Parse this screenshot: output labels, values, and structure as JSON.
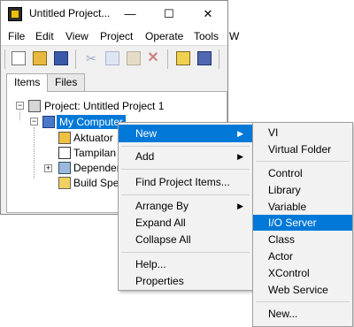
{
  "window": {
    "title": "Untitled Project...",
    "controls": {
      "minimize": "—",
      "maximize": "☐",
      "close": "✕"
    },
    "menu": [
      "File",
      "Edit",
      "View",
      "Project",
      "Operate",
      "Tools",
      "W"
    ],
    "tabs": [
      "Items",
      "Files"
    ],
    "active_tab": "Items"
  },
  "tree": {
    "project": "Project: Untitled Project 1",
    "computer": "My Computer",
    "children": [
      "Aktuator",
      "Tampilan",
      "Dependen",
      "Build Spe"
    ]
  },
  "context_menu": {
    "items": [
      "New",
      "Add",
      "Find Project Items...",
      "Arrange By",
      "Expand All",
      "Collapse All",
      "Help...",
      "Properties"
    ],
    "highlighted": "New"
  },
  "submenu": {
    "items": [
      "VI",
      "Virtual Folder",
      "Control",
      "Library",
      "Variable",
      "I/O Server",
      "Class",
      "Actor",
      "XControl",
      "Web Service",
      "New..."
    ],
    "highlighted": "I/O Server"
  },
  "colors": {
    "highlight": "#0078d7",
    "menu_bg": "#f2f2f2"
  }
}
